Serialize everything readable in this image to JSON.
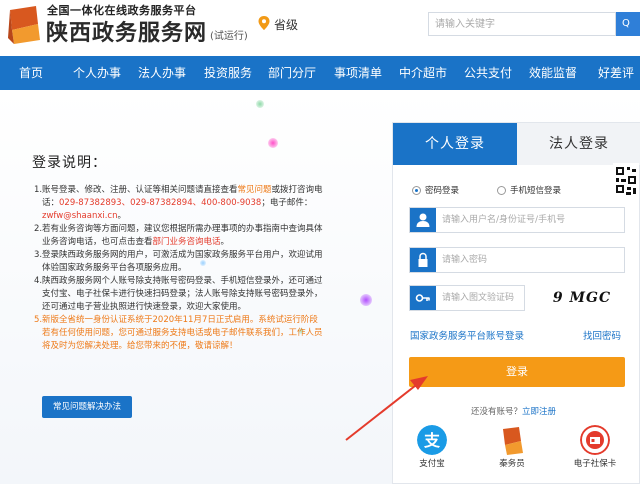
{
  "header": {
    "subtitle": "全国一体化在线政务服务平台",
    "title": "陕西政务服务网",
    "trial": "(试运行)",
    "location": "省级",
    "search_placeholder": "请输入关键字",
    "search_button": "Q"
  },
  "nav": {
    "items": [
      "首页",
      "个人办事",
      "法人办事",
      "投资服务",
      "部门分厅",
      "事项清单",
      "中介超市",
      "公共支付",
      "效能监督",
      "好差评"
    ]
  },
  "help": {
    "title": "登录说明：",
    "items": [
      {
        "num": "1.",
        "parts": [
          {
            "t": "账号登录、修改、注册、认证等相关问题请直接查看",
            "c": ""
          },
          {
            "t": "常见问题",
            "c": "orange"
          },
          {
            "t": "或拨打咨询电话：",
            "c": ""
          },
          {
            "t": "029-87382893、029-87382894、400-800-9038",
            "c": "red"
          },
          {
            "t": "；电子邮件：",
            "c": ""
          },
          {
            "t": "zwfw@shaanxi.cn",
            "c": "red"
          },
          {
            "t": "。",
            "c": ""
          }
        ]
      },
      {
        "num": "2.",
        "parts": [
          {
            "t": "若有业务咨询等方面问题，建议您根据所需办理事项的办事指南中查询具体业务咨询电话，也可点击查看",
            "c": ""
          },
          {
            "t": "部门业务咨询电话",
            "c": "red"
          },
          {
            "t": "。",
            "c": ""
          }
        ]
      },
      {
        "num": "3.",
        "parts": [
          {
            "t": "登录陕西政务服务网的用户，可激活成为国家政务服务平台用户，欢迎试用体验国家政务服务平台各项服务应用。",
            "c": ""
          }
        ]
      },
      {
        "num": "4.",
        "parts": [
          {
            "t": "陕西政务服务网个人账号除支持账号密码登录、手机短信登录外，还可通过支付宝、电子社保卡进行快速扫码登录；法人账号除支持账号密码登录外，还可通过电子营业执照进行快速登录，欢迎大家使用。",
            "c": ""
          }
        ]
      },
      {
        "num": "5.",
        "parts": [
          {
            "t": "新版全省统一身份认证系统于2020年11月7日正式启用。系统试运行阶段若有任何使用问题，您可通过服务支持电话或电子邮件联系我们，工作人员将及时为您解决处理。给您带来的不便，敬请谅解！",
            "c": "orange"
          }
        ]
      }
    ],
    "faq_button": "常见问题解决办法"
  },
  "login": {
    "tab_personal": "个人登录",
    "tab_legal": "法人登录",
    "radio_password": "密码登录",
    "radio_sms": "手机短信登录",
    "username_placeholder": "请输入用户名/身份证号/手机号",
    "password_placeholder": "请输入密码",
    "captcha_placeholder": "请输入图文验证码",
    "captcha_text": "9 MGC",
    "national_link": "国家政务服务平台账号登录",
    "forgot_link": "找回密码",
    "login_button": "登录",
    "no_account": "还没有账号？",
    "register_link": "立即注册",
    "alt_logins": [
      "支付宝",
      "秦务员",
      "电子社保卡"
    ]
  },
  "colors": {
    "primary": "#1a73c7",
    "orange": "#f59a16",
    "red_arrow": "#e43b2c"
  }
}
